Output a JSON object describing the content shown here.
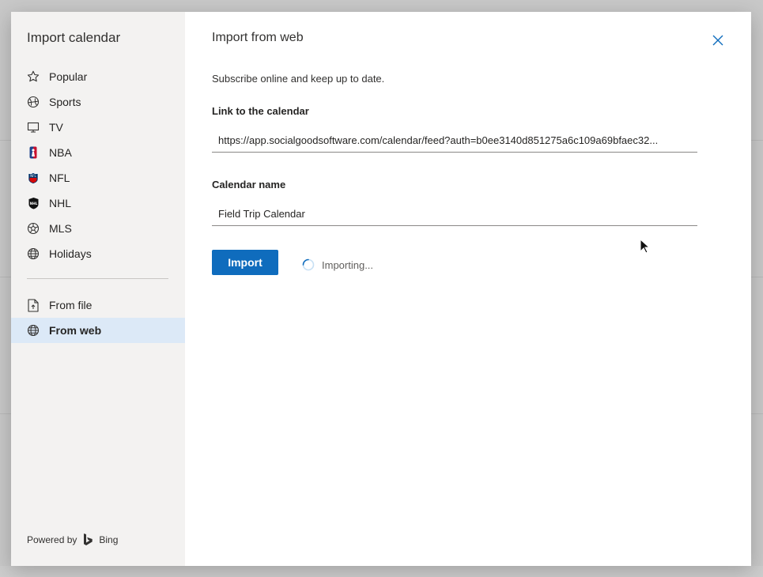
{
  "sidebar": {
    "title": "Import calendar",
    "items": [
      {
        "label": "Popular",
        "icon": "star-icon"
      },
      {
        "label": "Sports",
        "icon": "sports-ball-icon"
      },
      {
        "label": "TV",
        "icon": "tv-icon"
      },
      {
        "label": "NBA",
        "icon": "nba-icon"
      },
      {
        "label": "NFL",
        "icon": "nfl-icon"
      },
      {
        "label": "NHL",
        "icon": "nhl-icon"
      },
      {
        "label": "MLS",
        "icon": "soccer-ball-icon"
      },
      {
        "label": "Holidays",
        "icon": "globe-icon"
      }
    ],
    "source_items": [
      {
        "label": "From file",
        "icon": "file-upload-icon",
        "selected": false
      },
      {
        "label": "From web",
        "icon": "globe-icon",
        "selected": true
      }
    ],
    "powered_by": "Powered by",
    "bing_label": "Bing"
  },
  "main": {
    "title": "Import from web",
    "subtitle": "Subscribe online and keep up to date.",
    "link_label": "Link to the calendar",
    "link_value": "https://app.socialgoodsoftware.com/calendar/feed?auth=b0ee3140d851275a6c109a69bfaec32...",
    "name_label": "Calendar name",
    "name_value": "Field Trip Calendar",
    "import_button": "Import",
    "status_text": "Importing..."
  },
  "colors": {
    "accent": "#0f6cbd",
    "selected_bg": "#dce9f7",
    "sidebar_bg": "#f3f2f1",
    "close_icon": "#0f6cbd"
  }
}
